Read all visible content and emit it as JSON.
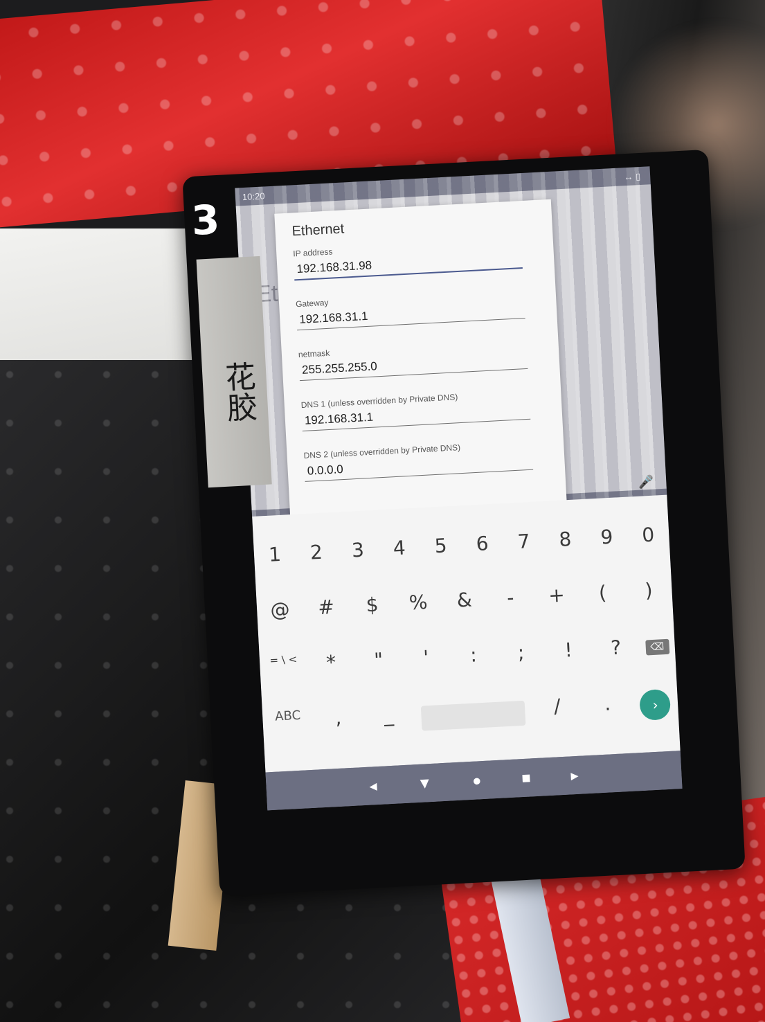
{
  "scene": {
    "marker_label": "3",
    "tape_label": "花胶"
  },
  "status_bar": {
    "time": "10:20",
    "right_icons": "↔ ▯"
  },
  "background_app": {
    "title": "Eth"
  },
  "dialog": {
    "title": "Ethernet",
    "fields": [
      {
        "label": "IP address",
        "value": "192.168.31.98",
        "focused": true
      },
      {
        "label": "Gateway",
        "value": "192.168.31.1",
        "focused": false
      },
      {
        "label": "netmask",
        "value": "255.255.255.0",
        "focused": false
      },
      {
        "label": "DNS 1 (unless overridden by Private DNS)",
        "value": "192.168.31.1",
        "focused": false
      },
      {
        "label": "DNS 2 (unless overridden by Private DNS)",
        "value": "0.0.0.0",
        "focused": false
      }
    ]
  },
  "keyboard": {
    "row1": [
      "1",
      "2",
      "3",
      "4",
      "5",
      "6",
      "7",
      "8",
      "9",
      "0"
    ],
    "row2": [
      "@",
      "#",
      "$",
      "%",
      "&",
      "-",
      "+",
      "(",
      ")"
    ],
    "row3_left": "= \\ <",
    "row3": [
      "*",
      "\"",
      "'",
      ":",
      ";",
      "!",
      "?"
    ],
    "backspace": "⌫",
    "row4_left": "ABC",
    "comma": ",",
    "underscore": "_",
    "slash": "/",
    "period": ".",
    "go": "›",
    "mic": "🎤"
  },
  "nav_bar": {
    "volume_down": "◂",
    "back": "▼",
    "home": "●",
    "recents": "■",
    "volume_up": "▸"
  }
}
